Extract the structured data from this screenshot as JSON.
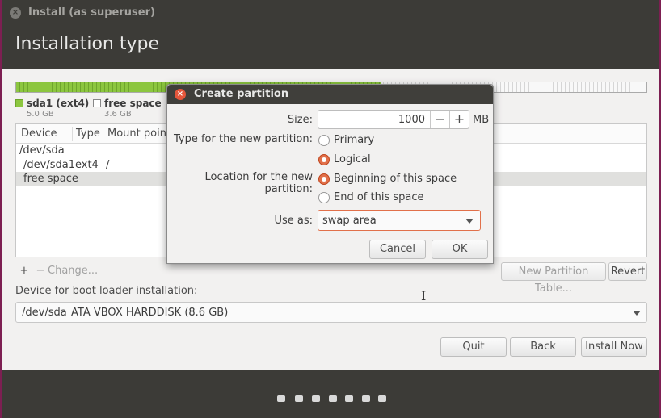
{
  "window": {
    "title": "Install (as superuser)",
    "header_title": "Installation type"
  },
  "legend": [
    {
      "label": "sda1 (ext4)",
      "size": "5.0 GB",
      "color": "#8cc63f"
    },
    {
      "label": "free space",
      "size": "3.6 GB",
      "color": "#ffffff"
    }
  ],
  "partition_bar": {
    "used_fraction": 0.58
  },
  "table": {
    "columns": [
      "Device",
      "Type",
      "Mount point"
    ],
    "rows": [
      {
        "device": "/dev/sda",
        "type": "",
        "mount": ""
      },
      {
        "device": "/dev/sda1",
        "type": "ext4",
        "mount": "/"
      },
      {
        "device": "free space",
        "type": "",
        "mount": "",
        "selected": true
      }
    ]
  },
  "table_buttons": {
    "add": "+",
    "remove": "−",
    "change": "Change...",
    "new_table": "New Partition Table...",
    "revert": "Revert"
  },
  "boot": {
    "label": "Device for boot loader installation:",
    "device": "/dev/sda",
    "description": "ATA VBOX HARDDISK (8.6 GB)"
  },
  "buttons": {
    "quit": "Quit",
    "back": "Back",
    "install": "Install Now"
  },
  "progress_dots": 7,
  "dialog": {
    "title": "Create partition",
    "size_label": "Size:",
    "size_value": "1000",
    "size_unit": "MB",
    "minus": "−",
    "plus": "+",
    "type_label": "Type for the new partition:",
    "type_options": [
      "Primary",
      "Logical"
    ],
    "type_selected": "Logical",
    "location_label": "Location for the new partition:",
    "location_options": [
      "Beginning of this space",
      "End of this space"
    ],
    "location_selected": "Beginning of this space",
    "use_as_label": "Use as:",
    "use_as_value": "swap area",
    "cancel": "Cancel",
    "ok": "OK"
  },
  "colors": {
    "accent": "#e1704a",
    "titlebar": "#3c3b37",
    "used_partition": "#8cc63f"
  },
  "icons": {
    "window_close": "×",
    "dialog_close": "×",
    "text_cursor": "I"
  }
}
